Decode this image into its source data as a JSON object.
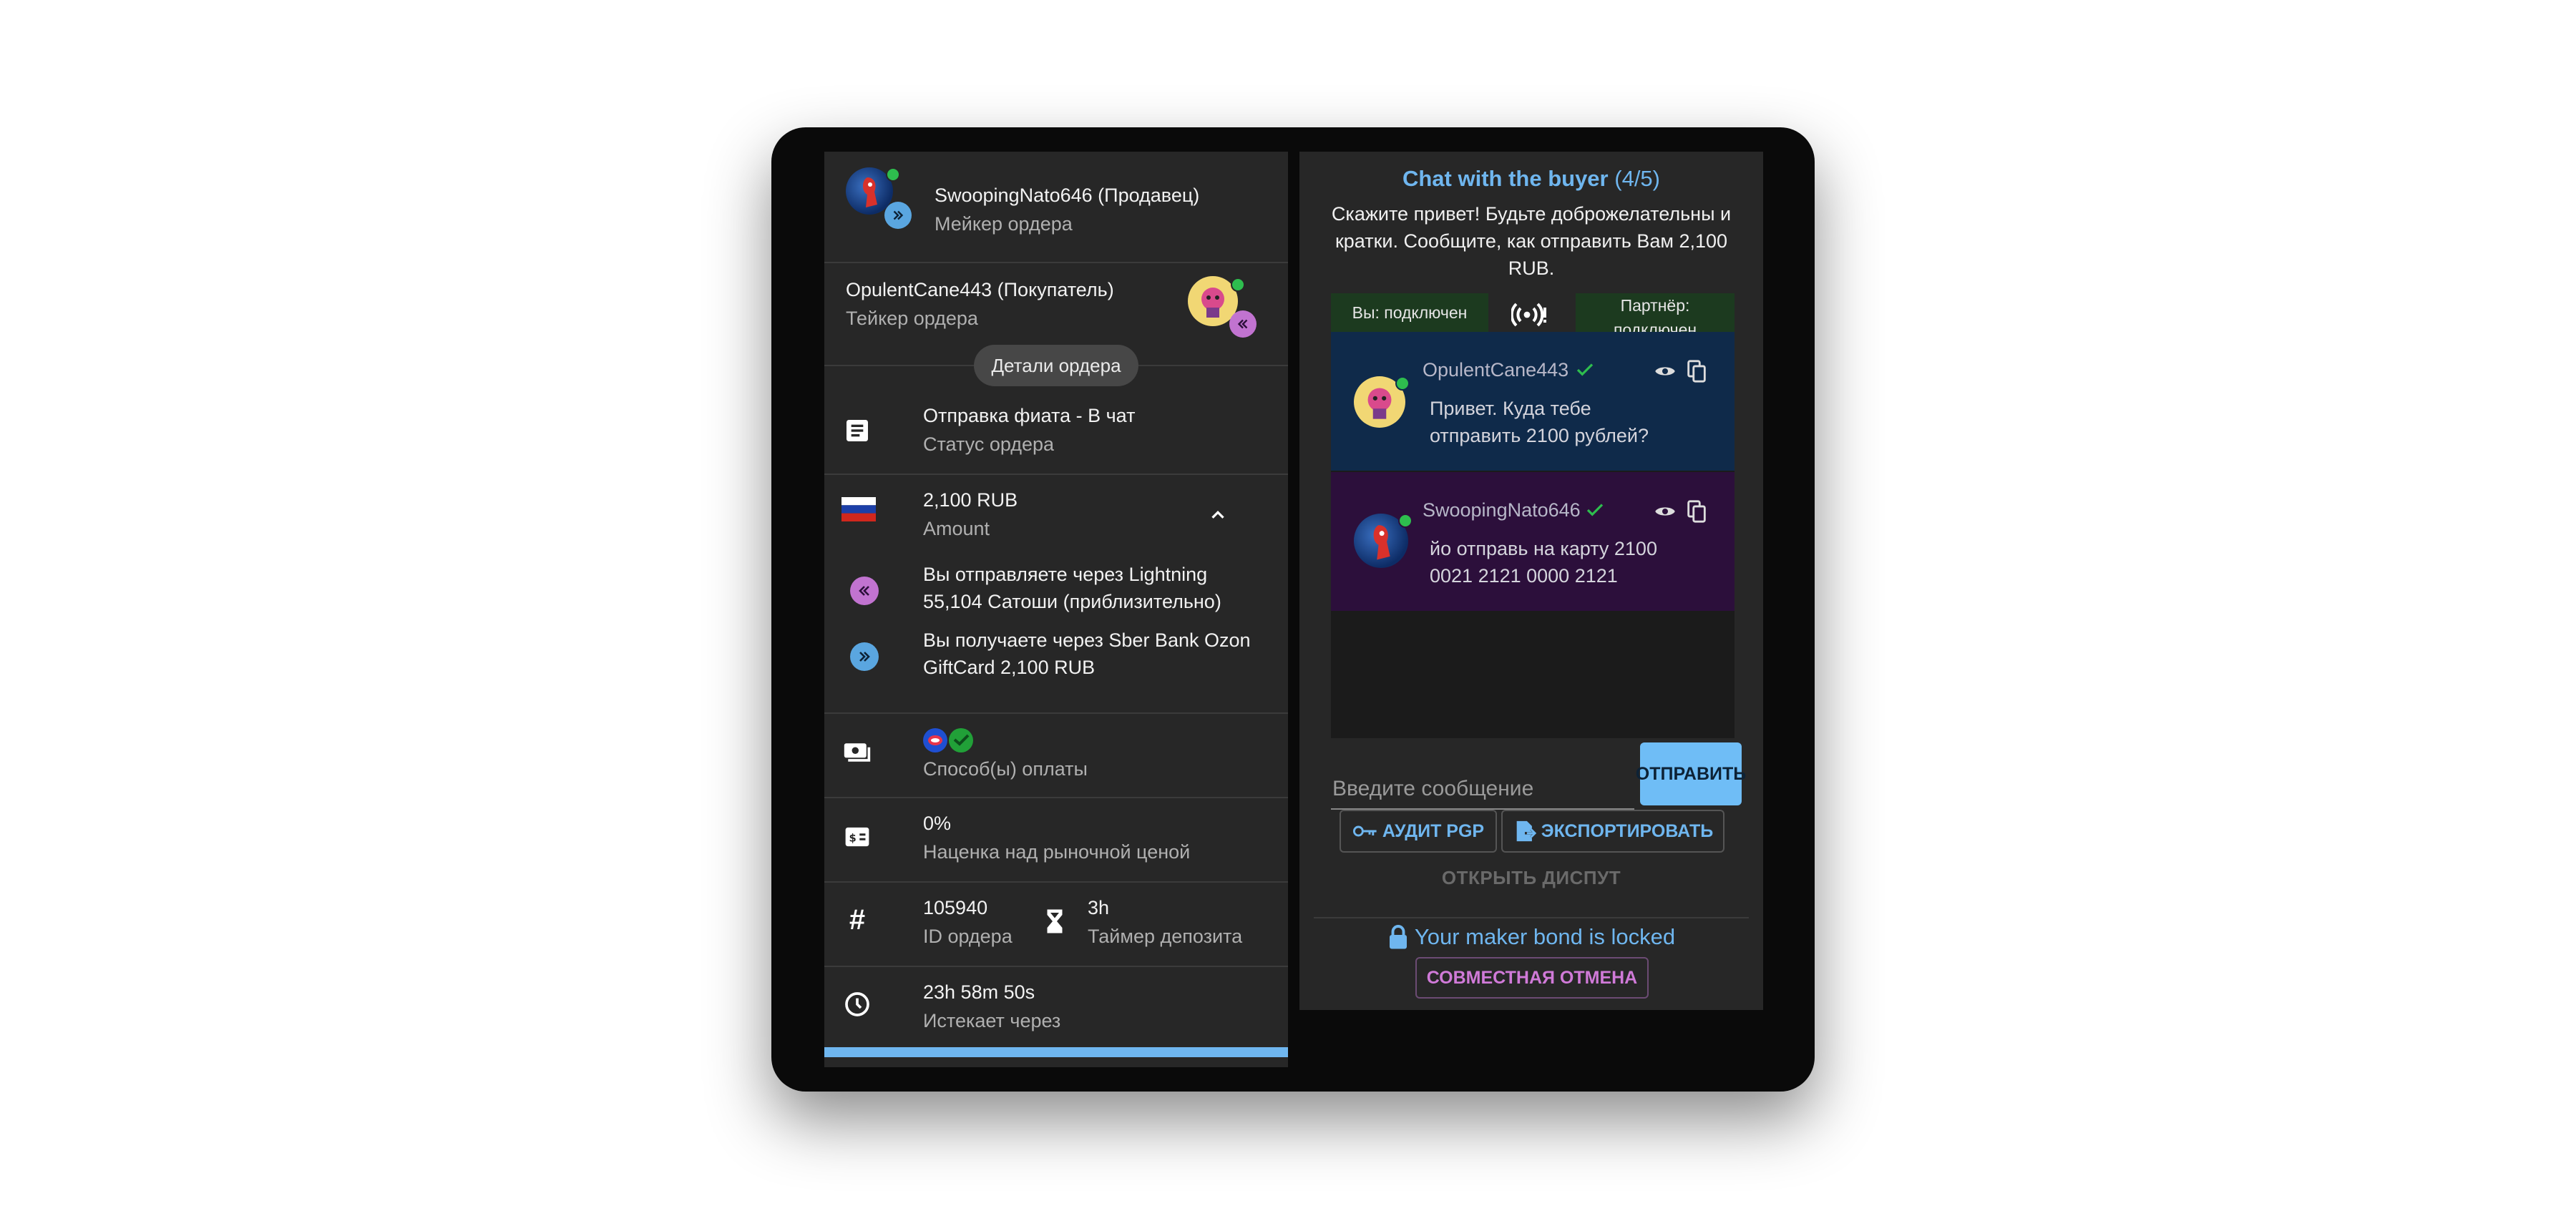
{
  "left": {
    "maker": {
      "name": "SwoopingNato646 (Продавец)",
      "role": "Мейкер ордера"
    },
    "taker": {
      "name": "OpulentCane443 (Покупатель)",
      "role": "Тейкер ордера"
    },
    "details_chip": "Детали ордера",
    "status": {
      "value": "Отправка фиата - В чат",
      "label": "Статус ордера"
    },
    "amount": {
      "value": "2,100 RUB",
      "label": "Amount"
    },
    "send": {
      "line1": "Вы отправляете через Lightning",
      "line2": "55,104 Сатоши (приблизительно)"
    },
    "receive": {
      "line1": "Вы получаете через Sber Bank Ozon",
      "line2": "GiftCard 2,100 RUB"
    },
    "payment": {
      "label": "Способ(ы) оплаты"
    },
    "premium": {
      "value": "0%",
      "label": "Наценка над рыночной ценой"
    },
    "order_id": {
      "value": "105940",
      "label": "ID ордера"
    },
    "deposit_timer": {
      "value": "3h",
      "label": "Таймер депозита"
    },
    "expires": {
      "value": "23h 58m 50s",
      "label": "Истекает через"
    }
  },
  "right": {
    "title": "Chat with the buyer",
    "title_count": "(4/5)",
    "intro": "Скажите привет! Будьте доброжелательны и кратки. Сообщите, как отправить Вам 2,100 RUB.",
    "status_you": "Вы: подключен",
    "status_partner_line1": "Партнёр:",
    "status_partner_line2": "подключен",
    "messages": [
      {
        "author": "OpulentCane443",
        "line1": "Привет. Куда тебе",
        "line2": "отправить 2100 рублей?"
      },
      {
        "author": "SwoopingNato646",
        "line1": "йо отправь на карту 2100",
        "line2": "0021 2121 0000 2121"
      }
    ],
    "input_placeholder": "Введите сообщение",
    "send_label": "ОТПРАВИТЬ",
    "audit_label": "АУДИТ PGP",
    "export_label": "ЭКСПОРТИРОВАТЬ",
    "dispute_label": "ОТКРЫТЬ ДИСПУТ",
    "bond_text": "Your maker bond is locked",
    "coop_cancel_label": "СОВМЕСТНАЯ ОТМЕНА"
  },
  "colors": {
    "accent": "#6fb6ef",
    "panel": "#272727",
    "online": "#2ebd4e",
    "buyer_msg": "#0f2a4a",
    "seller_msg": "#2c0f3b",
    "coop": "#d07ad8"
  }
}
